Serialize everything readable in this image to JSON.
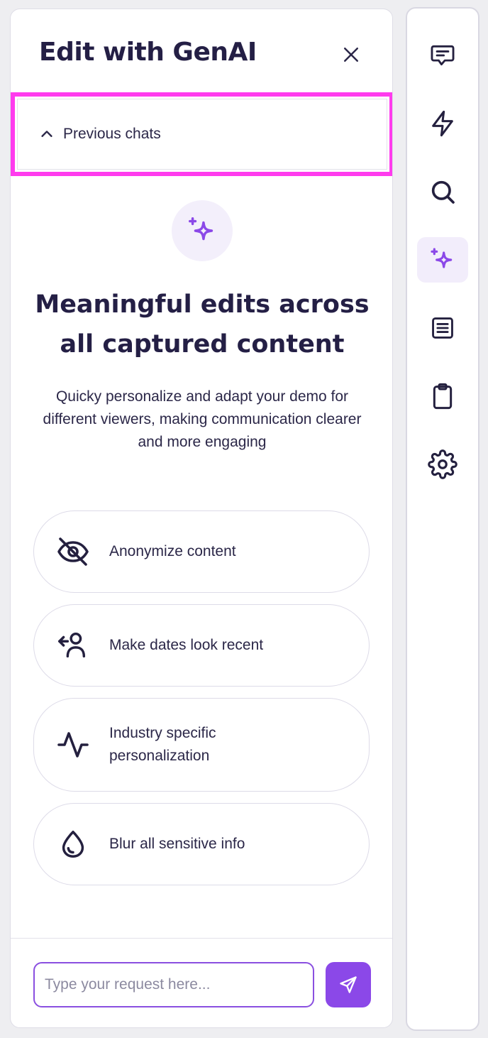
{
  "panel": {
    "title": "Edit with GenAI",
    "previous_chats_label": "Previous chats"
  },
  "hero": {
    "title": "Meaningful edits across all captured content",
    "description": "Quicky personalize and adapt your demo for different viewers, making communication clearer and more engaging"
  },
  "suggestions": [
    {
      "label": "Anonymize content",
      "icon": "eye-off-icon"
    },
    {
      "label": "Make dates look recent",
      "icon": "user-arrow-icon"
    },
    {
      "label": "Industry specific personalization",
      "icon": "activity-icon"
    },
    {
      "label": "Blur all sensitive info",
      "icon": "droplet-icon"
    }
  ],
  "input": {
    "placeholder": "Type your request here..."
  },
  "rail": {
    "items": [
      {
        "icon": "message-icon",
        "active": false
      },
      {
        "icon": "lightning-icon",
        "active": false
      },
      {
        "icon": "search-icon",
        "active": false
      },
      {
        "icon": "sparkles-icon",
        "active": true
      },
      {
        "icon": "document-list-icon",
        "active": false
      },
      {
        "icon": "clipboard-icon",
        "active": false
      },
      {
        "icon": "gear-icon",
        "active": false
      }
    ]
  },
  "colors": {
    "accent": "#8b48e8",
    "highlight": "#ff3bee",
    "text": "#241f45"
  }
}
